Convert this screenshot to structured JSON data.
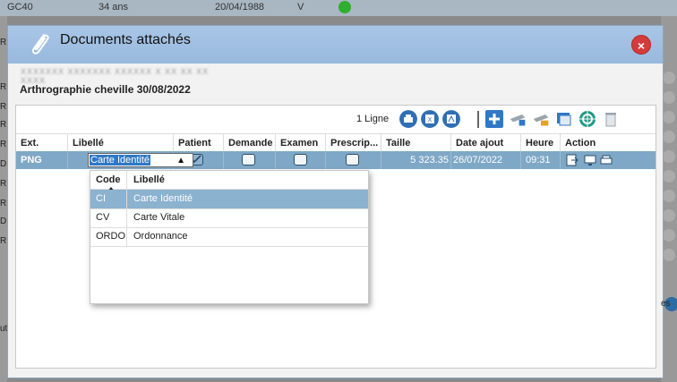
{
  "background": {
    "row_cells": [
      "GC40",
      "34 ans",
      "20/04/1988",
      "V"
    ],
    "left_letters": [
      "R",
      "R",
      "R",
      "R",
      "R",
      "D",
      "R",
      "R",
      "D",
      "R"
    ],
    "right_fragment": "es",
    "left_fragment": "ut"
  },
  "dialog": {
    "title": "Documents attachés",
    "close_label": "×",
    "patient_id": "XXXXXXX XXXXXXX XXXXXX X XX XX XX XXXX",
    "subtitle": "Arthrographie cheville 30/08/2022"
  },
  "toolbar": {
    "count": "1 Ligne",
    "icons": [
      "print-icon",
      "excel-icon",
      "pdf-icon",
      "add-icon",
      "scan-add-icon",
      "scan-folder-icon",
      "image-icon",
      "target-icon",
      "trash-icon"
    ]
  },
  "table": {
    "headers": [
      "Ext.",
      "Libellé",
      "Patient",
      "Demande",
      "Examen",
      "Prescrip...",
      "Taille",
      "Date ajout",
      "Heure",
      "Action"
    ],
    "row": {
      "ext": "PNG",
      "libelle": "Carte Identité",
      "patient": true,
      "demande": false,
      "examen": false,
      "prescrip": false,
      "taille": "5 323.35",
      "date": "26/07/2022",
      "heure": "09:31"
    }
  },
  "dropdown": {
    "headers": [
      "Code",
      "Libellé"
    ],
    "items": [
      {
        "code": "CI",
        "label": "Carte Identité",
        "selected": true
      },
      {
        "code": "CV",
        "label": "Carte Vitale",
        "selected": false
      },
      {
        "code": "ORDO",
        "label": "Ordonnance",
        "selected": false
      }
    ]
  },
  "colors": {
    "titlebar": "#a9c6e6",
    "selected_row": "#7fa8c6",
    "close_button": "#d43b3b",
    "accent_blue": "#2f78c6"
  }
}
